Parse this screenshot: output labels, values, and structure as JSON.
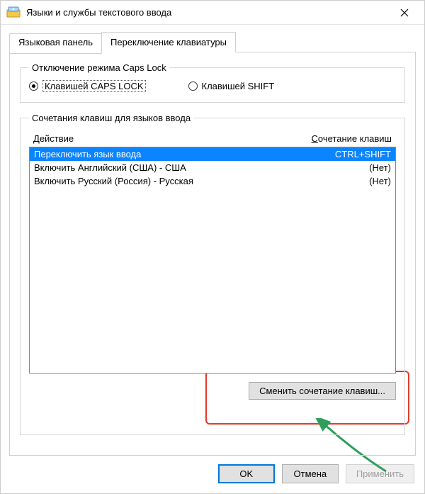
{
  "window": {
    "title": "Языки и службы текстового ввода"
  },
  "tabs": {
    "language_bar": "Языковая панель",
    "keyboard_switch": "Переключение клавиатуры"
  },
  "caps_group": {
    "legend": "Отключение режима Caps Lock",
    "option_caps": "Клавишей CAPS LOCK",
    "option_shift": "Клавишей SHIFT"
  },
  "keys_group": {
    "legend": "Сочетания клавиш для языков ввода",
    "header_action": "Действие",
    "header_key": "Сочетание клавиш",
    "rows": [
      {
        "action": "Переключить язык ввода",
        "key": "CTRL+SHIFT",
        "selected": true
      },
      {
        "action": "Включить Английский (США) - США",
        "key": "(Нет)",
        "selected": false
      },
      {
        "action": "Включить Русский (Россия) - Русская",
        "key": "(Нет)",
        "selected": false
      }
    ],
    "change_button": "Сменить сочетание клавиш..."
  },
  "footer": {
    "ok": "OK",
    "cancel": "Отмена",
    "apply": "Применить"
  }
}
